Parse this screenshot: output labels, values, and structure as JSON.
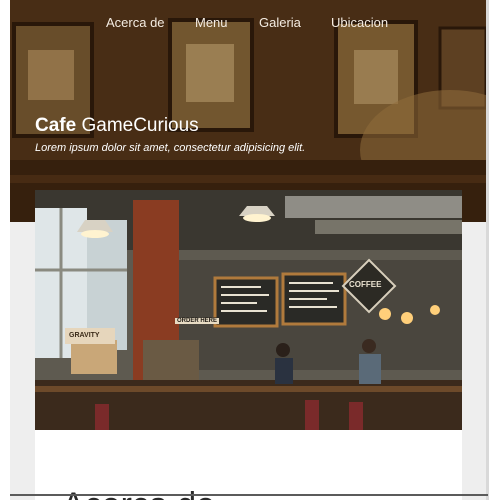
{
  "nav": {
    "items": [
      {
        "label": "Acerca de"
      },
      {
        "label": "Menu"
      },
      {
        "label": "Galeria"
      },
      {
        "label": "Ubicacion"
      }
    ]
  },
  "hero": {
    "brand_bold": "Cafe",
    "brand_rest": "GameCurious",
    "tagline": "Lorem ipsum dolor sit amet, consectetur adipisicing elit."
  },
  "photo": {
    "sign_coffee": "COFFEE",
    "sign_order": "ORDER HERE",
    "sign_gravity": "GRAVITY"
  },
  "section": {
    "title": "Acerca de"
  },
  "colors": {
    "hero_overlay": "#3a2412",
    "nav_text": "#f4ece2",
    "page_bg": "#eeeeee"
  }
}
